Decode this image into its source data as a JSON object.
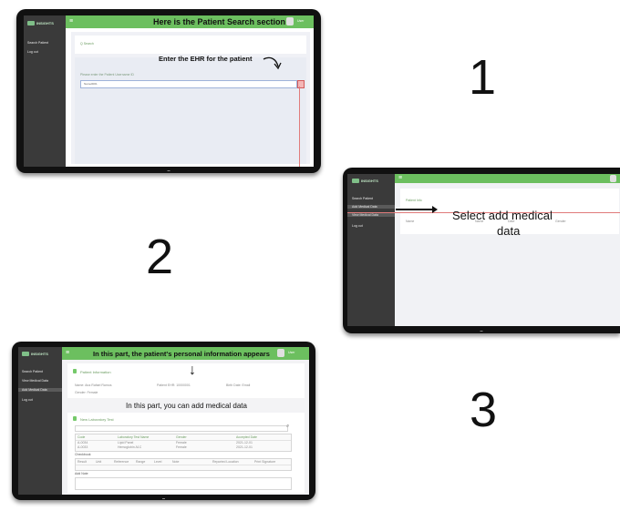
{
  "steps": [
    "1",
    "2",
    "3"
  ],
  "panel1": {
    "app_name": "INSIGHTS",
    "nav": [
      "Search Patient",
      "Log out"
    ],
    "title": "Here is the Patient Search section",
    "user": "User",
    "search_tab": "Q Search",
    "field_label": "Please enter the Patient Username ID",
    "field_value": "Name0001",
    "annotation": "Enter the EHR for the patient"
  },
  "panel2": {
    "app_name": "INSIGHTS",
    "nav": [
      "Search Patient",
      "Add Medical Data",
      "View Medical Data",
      "Log out"
    ],
    "tab": "Patient Info",
    "annotation_line1": "Select add medical",
    "annotation_line2": "data",
    "row": [
      "Name",
      "Name",
      "Date",
      "Gender"
    ]
  },
  "panel3": {
    "app_name": "INSIGHTS",
    "nav": [
      "Search Patient",
      "View Medical Data",
      "Add Medical Data",
      "Log out"
    ],
    "title": "In this part, the patient's personal information appears",
    "user": "User",
    "section1": "Patient Information",
    "info": [
      "Name: Ana Rafael Ramos",
      "Patient EHR: 10000001",
      "Birth Date: Email",
      "Gender: Female"
    ],
    "annotation2": "In this part, you can add medical data",
    "section2": "New Laboratory Test",
    "table_headers": [
      "Code",
      "Laboratory Test Name",
      "Gender",
      "Accepted Date"
    ],
    "table_rows": [
      [
        "A-0034",
        "Lipid Panel",
        "Female",
        "2021-12-01"
      ],
      [
        "A-0033",
        "Hemoglobin A1C",
        "Female",
        "2021-12-01"
      ]
    ],
    "sub_label": "Checkbook",
    "sub_headers": [
      "Result",
      "Unit",
      "Reference",
      "Range",
      "Level",
      "Note",
      "Reported Location",
      "Print Signature"
    ],
    "sub_label2": "Add Note"
  }
}
